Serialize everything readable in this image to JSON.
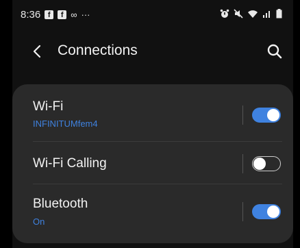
{
  "status_bar": {
    "time": "8:36",
    "notification_icons": [
      "facebook-icon",
      "facebook-icon",
      "voicemail-icon"
    ],
    "overflow": "···",
    "right_icons": [
      "alarm-icon",
      "mute-icon",
      "wifi-icon",
      "signal-icon",
      "battery-icon"
    ]
  },
  "header": {
    "title": "Connections"
  },
  "settings": [
    {
      "title": "Wi-Fi",
      "subtitle": "INFINITUMfem4",
      "toggle": "on"
    },
    {
      "title": "Wi-Fi Calling",
      "subtitle": "",
      "toggle": "off"
    },
    {
      "title": "Bluetooth",
      "subtitle": "On",
      "toggle": "on"
    }
  ],
  "colors": {
    "accent": "#3f82e0",
    "card": "#2a2a2a",
    "background": "#111111"
  }
}
